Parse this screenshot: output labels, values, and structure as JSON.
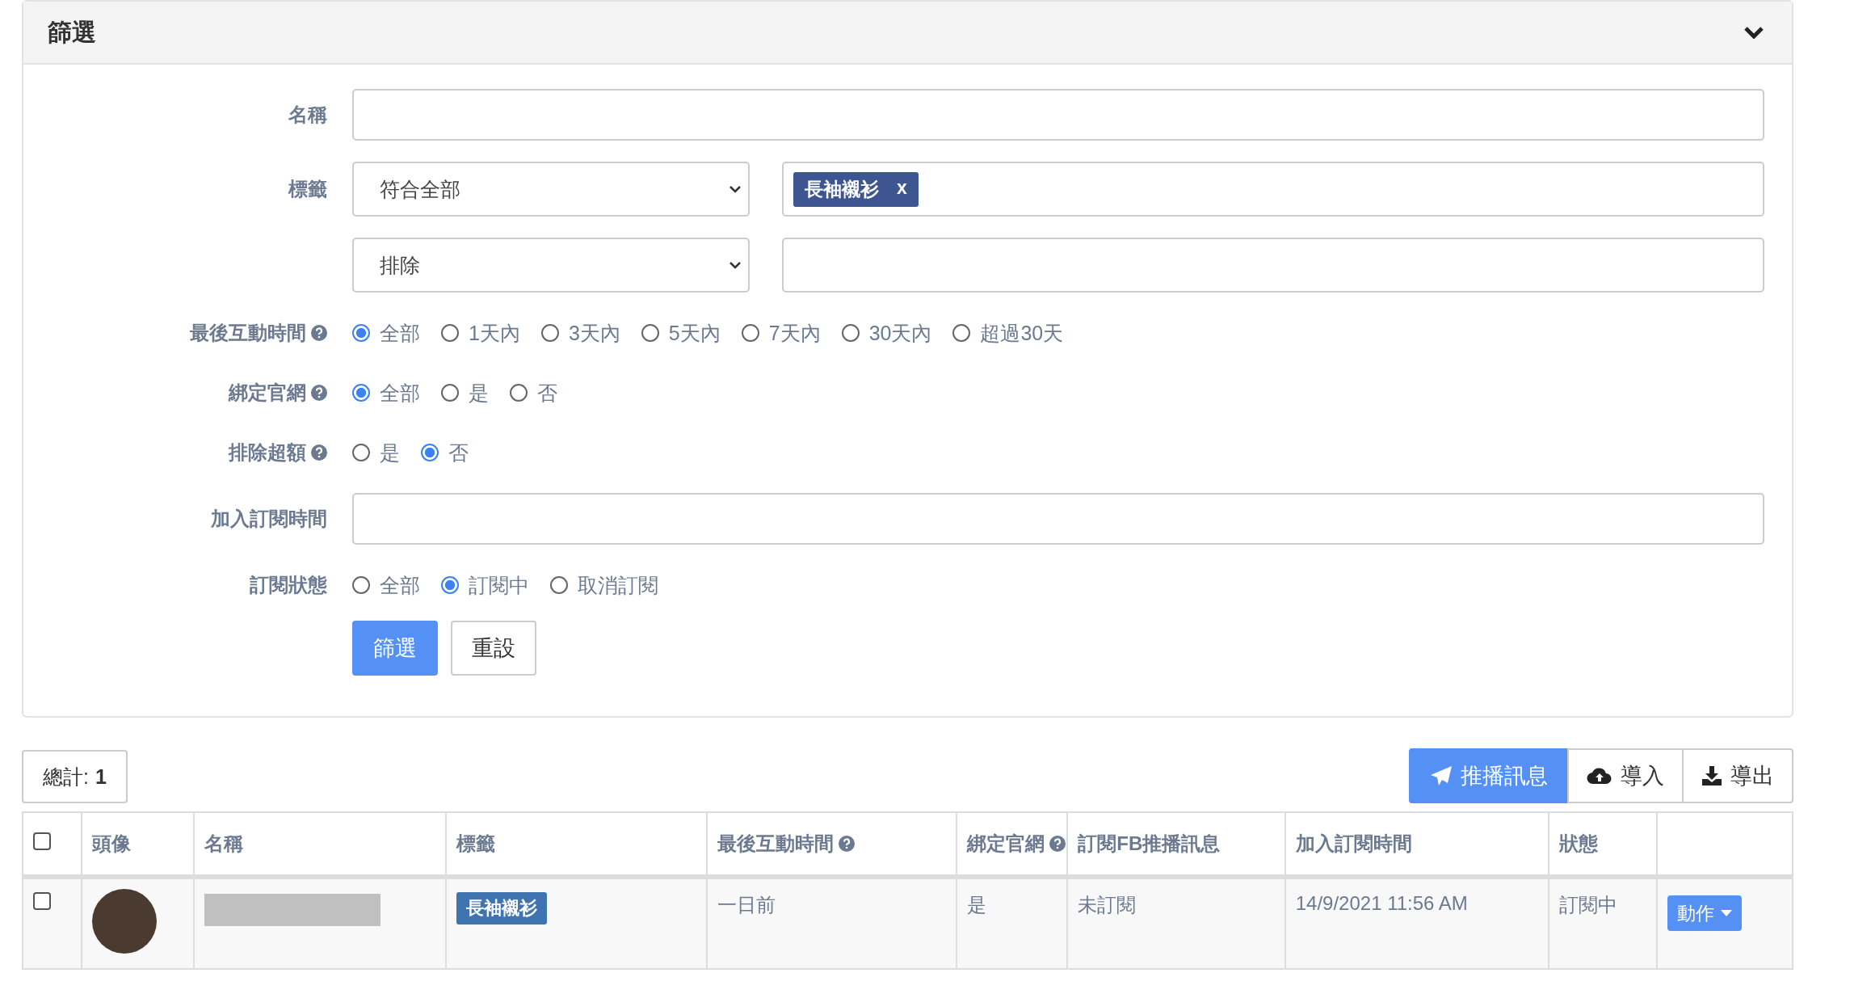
{
  "filter_panel": {
    "title": "篩選",
    "rows": [
      {
        "kind": "text",
        "label": "名稱"
      },
      {
        "kind": "tags",
        "label": "標籤",
        "mode": "符合全部",
        "tags": [
          {
            "label": "長袖襯衫",
            "remove": "x"
          }
        ]
      },
      {
        "kind": "tags",
        "mode": "排除"
      },
      {
        "kind": "radio",
        "label": "最後互動時間",
        "help": true,
        "options": [
          {
            "label": "全部",
            "selected": true
          },
          {
            "label": "1天內",
            "selected": false
          },
          {
            "label": "3天內",
            "selected": false
          },
          {
            "label": "5天內",
            "selected": false
          },
          {
            "label": "7天內",
            "selected": false
          },
          {
            "label": "30天內",
            "selected": false
          },
          {
            "label": "超過30天",
            "selected": false
          }
        ]
      },
      {
        "kind": "radio",
        "label": "綁定官網",
        "help": true,
        "options": [
          {
            "label": "全部",
            "selected": true
          },
          {
            "label": "是",
            "selected": false
          },
          {
            "label": "否",
            "selected": false
          }
        ]
      },
      {
        "kind": "radio",
        "label": "排除超額",
        "help": true,
        "options": [
          {
            "label": "是",
            "selected": false
          },
          {
            "label": "否",
            "selected": true
          }
        ]
      },
      {
        "kind": "text",
        "label": "加入訂閱時間"
      },
      {
        "kind": "radio",
        "label": "訂閱狀態",
        "help": false,
        "options": [
          {
            "label": "全部",
            "selected": false
          },
          {
            "label": "訂閱中",
            "selected": true
          },
          {
            "label": "取消訂閱",
            "selected": false
          }
        ]
      }
    ],
    "buttons": [
      {
        "label": "篩選",
        "primary": true
      },
      {
        "label": "重設",
        "primary": false
      }
    ]
  },
  "total": {
    "label": "總計:",
    "value": "1"
  },
  "actions": [
    {
      "label": "推播訊息",
      "primary": true
    },
    {
      "label": "導入",
      "primary": false
    },
    {
      "label": "導出",
      "primary": false
    }
  ],
  "table": {
    "header_checkbox": {
      "checked": false
    },
    "columns": [
      {
        "label": "頭像",
        "help": false
      },
      {
        "label": "名稱",
        "help": false
      },
      {
        "label": "標籤",
        "help": false
      },
      {
        "label": "最後互動時間",
        "help": true
      },
      {
        "label": "綁定官網",
        "help": true
      },
      {
        "label": "訂閱FB推播訊息",
        "help": false
      },
      {
        "label": "加入訂閱時間",
        "help": false
      },
      {
        "label": "狀態",
        "help": false
      }
    ],
    "rows": [
      {
        "checked": false,
        "tags": [
          "長袖襯衫"
        ],
        "last_interaction": "一日前",
        "bound": "是",
        "fb_subscription": "未訂閱",
        "joined": "14/9/2021 11:56 AM",
        "status": "訂閱中",
        "action": "動作"
      }
    ]
  }
}
